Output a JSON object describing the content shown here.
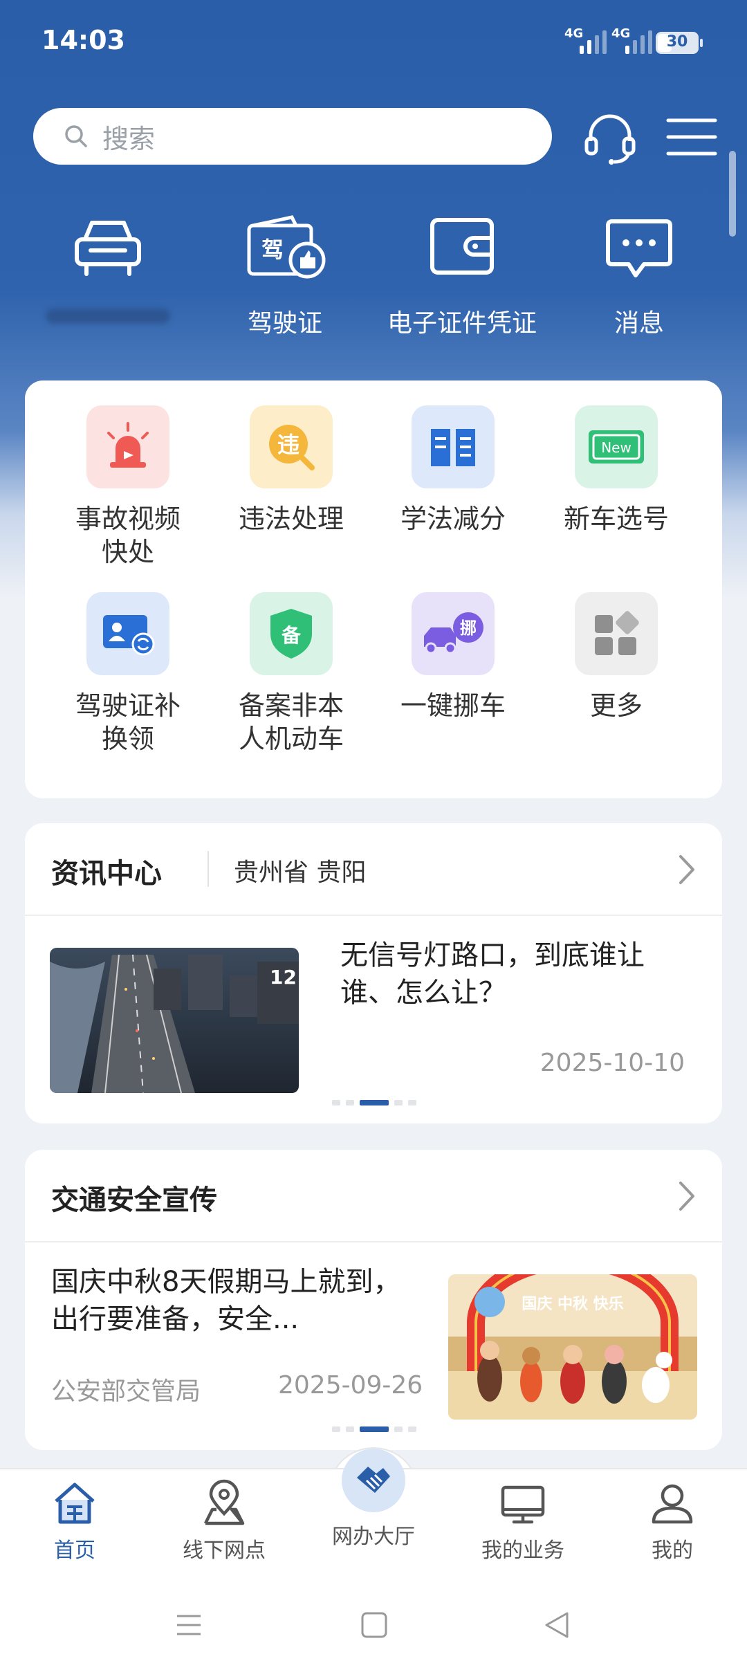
{
  "status_bar": {
    "time": "14:03",
    "signal1": "4G",
    "signal2": "4G",
    "battery": "30"
  },
  "header": {
    "search_placeholder": "搜索",
    "icons": [
      "headset-icon",
      "menu-icon"
    ]
  },
  "top_shortcuts": [
    {
      "label": "",
      "icon": "car-icon"
    },
    {
      "label": "驾驶证",
      "icon": "driver-license-icon"
    },
    {
      "label": "电子证件凭证",
      "icon": "wallet-icon"
    },
    {
      "label": "消息",
      "icon": "message-icon"
    }
  ],
  "services": [
    {
      "label": "事故视频\n快处",
      "icon": "alarm-light-icon",
      "icon_text": ""
    },
    {
      "label": "违法处理",
      "icon": "violation-icon",
      "icon_text": "违"
    },
    {
      "label": "学法减分",
      "icon": "book-icon",
      "icon_text": ""
    },
    {
      "label": "新车选号",
      "icon": "new-plate-icon",
      "icon_text": "New"
    },
    {
      "label": "驾驶证补\n换领",
      "icon": "license-renew-icon",
      "icon_text": ""
    },
    {
      "label": "备案非本\n人机动车",
      "icon": "shield-record-icon",
      "icon_text": "备"
    },
    {
      "label": "一键挪车",
      "icon": "move-car-icon",
      "icon_text": "挪"
    },
    {
      "label": "更多",
      "icon": "more-grid-icon",
      "icon_text": ""
    }
  ],
  "news": {
    "title": "资讯中心",
    "location": "贵州省 贵阳",
    "item_title": "无信号灯路口，到底谁让谁、怎么让？",
    "item_date": "2025-10-10",
    "image_text": "12"
  },
  "safety": {
    "title": "交通安全宣传",
    "item_title": "国庆中秋8天假期马上就到，出行要准备，安全...",
    "item_source": "公安部交管局",
    "item_date": "2025-09-26",
    "banner_text": "国庆 中秋 快乐"
  },
  "tabbar": [
    {
      "label": "首页",
      "icon": "home-icon",
      "active": true
    },
    {
      "label": "线下网点",
      "icon": "location-pin-icon",
      "active": false
    },
    {
      "label": "网办大厅",
      "icon": "handshake-icon",
      "active": false
    },
    {
      "label": "我的业务",
      "icon": "monitor-icon",
      "active": false
    },
    {
      "label": "我的",
      "icon": "user-icon",
      "active": false
    }
  ],
  "colors": {
    "brand_blue": "#2a5ea8",
    "card_bg": "#ffffff",
    "page_bg": "#eef1f6"
  }
}
